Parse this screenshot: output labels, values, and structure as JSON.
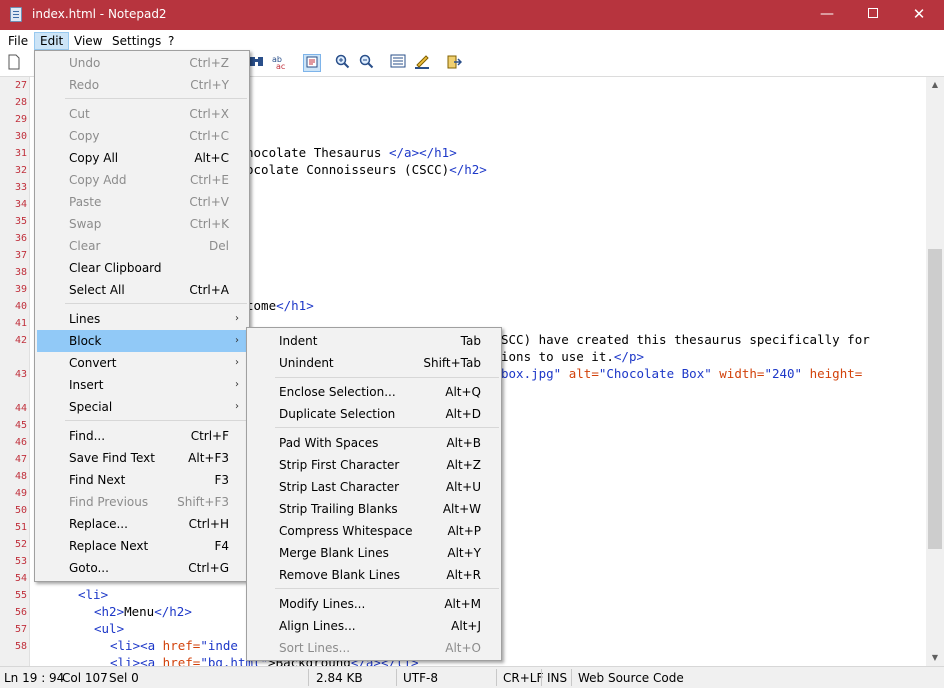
{
  "window": {
    "title": "index.html - Notepad2",
    "min": "—",
    "max": "",
    "close": "✕"
  },
  "menubar": [
    "File",
    "Edit",
    "View",
    "Settings",
    "?"
  ],
  "toolbar_icons": [
    "new-file-icon",
    "open-file-icon",
    "find-icon",
    "replace-icon",
    "wordwrap-icon",
    "zoom-in-icon",
    "zoom-out-icon",
    "scheme-icon",
    "customize-scheme-icon",
    "favorites-icon"
  ],
  "editor": {
    "line_numbers": [
      "27",
      "28",
      "29",
      "30",
      "31",
      "32",
      "33",
      "34",
      "35",
      "36",
      "37",
      "38",
      "39",
      "40",
      "41",
      "42",
      "43",
      "44",
      "45",
      "46",
      "47",
      "48",
      "49",
      "50",
      "51",
      "52",
      "53",
      "54",
      "55",
      "56",
      "57",
      "58"
    ],
    "lines": {
      "l31": {
        "text": "hocolate Thesaurus ",
        "tag": "</a></h1>"
      },
      "l32": {
        "text": "ocolate Connoisseurs (CSCC)",
        "tag": "</h2>"
      },
      "l40": {
        "text": "tome",
        "tag": "</h1>"
      },
      "l42a": {
        "text": "SCC) have created this thesaurus specifically for"
      },
      "l42b": {
        "text": "ions to use it.",
        "tag": "</p>"
      },
      "l43": {
        "v1": "box.jpg\"",
        "a1": " alt=",
        "v2": "\"Chocolate Box\"",
        "a2": " width=",
        "v3": "\"240\"",
        "a3": " height="
      },
      "l55": {
        "tag": "<li>"
      },
      "l56": {
        "tag1": "<h2>",
        "text": "Menu",
        "tag2": "</h2>"
      },
      "l57": {
        "tag": "<ul>"
      },
      "l58": {
        "tag": "<li><a",
        "attr": " href=",
        "val": "\"inde"
      },
      "l59": {
        "tag": "<li><a",
        "attr": " href=",
        "val": "\"bg.html\"",
        "text": ">Background",
        "tag2": "</a></li>"
      }
    }
  },
  "edit_menu": {
    "items": [
      {
        "label": "Undo",
        "shortcut": "Ctrl+Z",
        "disabled": true
      },
      {
        "label": "Redo",
        "shortcut": "Ctrl+Y",
        "disabled": true
      },
      {
        "label": "Cut",
        "shortcut": "Ctrl+X",
        "disabled": true
      },
      {
        "label": "Copy",
        "shortcut": "Ctrl+C",
        "disabled": true
      },
      {
        "label": "Copy All",
        "shortcut": "Alt+C",
        "disabled": false
      },
      {
        "label": "Copy Add",
        "shortcut": "Ctrl+E",
        "disabled": true
      },
      {
        "label": "Paste",
        "shortcut": "Ctrl+V",
        "disabled": true
      },
      {
        "label": "Swap",
        "shortcut": "Ctrl+K",
        "disabled": true
      },
      {
        "label": "Clear",
        "shortcut": "Del",
        "disabled": true
      },
      {
        "label": "Clear Clipboard",
        "shortcut": "",
        "disabled": false
      },
      {
        "label": "Select All",
        "shortcut": "Ctrl+A",
        "disabled": false
      },
      {
        "label": "Lines",
        "shortcut": "",
        "disabled": false
      },
      {
        "label": "Block",
        "shortcut": "",
        "disabled": false
      },
      {
        "label": "Convert",
        "shortcut": "",
        "disabled": false
      },
      {
        "label": "Insert",
        "shortcut": "",
        "disabled": false
      },
      {
        "label": "Special",
        "shortcut": "",
        "disabled": false
      },
      {
        "label": "Find...",
        "shortcut": "Ctrl+F",
        "disabled": false
      },
      {
        "label": "Save Find Text",
        "shortcut": "Alt+F3",
        "disabled": false
      },
      {
        "label": "Find Next",
        "shortcut": "F3",
        "disabled": false
      },
      {
        "label": "Find Previous",
        "shortcut": "Shift+F3",
        "disabled": true
      },
      {
        "label": "Replace...",
        "shortcut": "Ctrl+H",
        "disabled": false
      },
      {
        "label": "Replace Next",
        "shortcut": "F4",
        "disabled": false
      },
      {
        "label": "Goto...",
        "shortcut": "Ctrl+G",
        "disabled": false
      }
    ],
    "submenu_arrow": "›"
  },
  "block_menu": {
    "items": [
      {
        "label": "Indent",
        "shortcut": "Tab",
        "disabled": false
      },
      {
        "label": "Unindent",
        "shortcut": "Shift+Tab",
        "disabled": false
      },
      {
        "label": "Enclose Selection...",
        "shortcut": "Alt+Q",
        "disabled": false
      },
      {
        "label": "Duplicate Selection",
        "shortcut": "Alt+D",
        "disabled": false
      },
      {
        "label": "Pad With Spaces",
        "shortcut": "Alt+B",
        "disabled": false
      },
      {
        "label": "Strip First Character",
        "shortcut": "Alt+Z",
        "disabled": false
      },
      {
        "label": "Strip Last Character",
        "shortcut": "Alt+U",
        "disabled": false
      },
      {
        "label": "Strip Trailing Blanks",
        "shortcut": "Alt+W",
        "disabled": false
      },
      {
        "label": "Compress Whitespace",
        "shortcut": "Alt+P",
        "disabled": false
      },
      {
        "label": "Merge Blank Lines",
        "shortcut": "Alt+Y",
        "disabled": false
      },
      {
        "label": "Remove Blank Lines",
        "shortcut": "Alt+R",
        "disabled": false
      },
      {
        "label": "Modify Lines...",
        "shortcut": "Alt+M",
        "disabled": false
      },
      {
        "label": "Align Lines...",
        "shortcut": "Alt+J",
        "disabled": false
      },
      {
        "label": "Sort Lines...",
        "shortcut": "Alt+O",
        "disabled": true
      }
    ]
  },
  "statusbar": {
    "position": "Ln 19 : 94",
    "col": "Col 107",
    "sel": "Sel 0",
    "size": "2.84 KB",
    "encoding": "UTF-8",
    "eol": "CR+LF",
    "mode": "INS",
    "scheme": "Web Source Code"
  },
  "colors": {
    "titlebar": "#b7343e",
    "highlight": "#91c9f7",
    "line_number": "#c0303c",
    "tag": "#1d38c8",
    "attribute": "#d2420b"
  }
}
